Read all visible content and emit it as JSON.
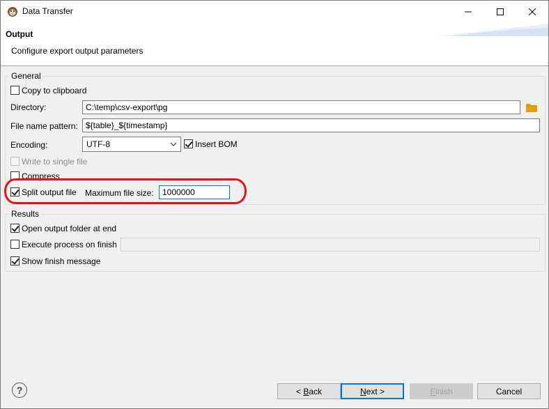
{
  "window": {
    "title": "Data Transfer",
    "icon": "dbeaver-beaver-icon"
  },
  "header": {
    "title": "Output",
    "description": "Configure export output parameters"
  },
  "general": {
    "legend": "General",
    "copy_to_clipboard": {
      "label": "Copy to clipboard",
      "checked": false
    },
    "directory": {
      "label": "Directory:",
      "value": "C:\\temp\\csv-export\\pg"
    },
    "file_name_pattern": {
      "label": "File name pattern:",
      "value": "${table}_${timestamp}"
    },
    "encoding": {
      "label": "Encoding:",
      "value": "UTF-8"
    },
    "insert_bom": {
      "label": "Insert BOM",
      "checked": true
    },
    "write_single_file": {
      "label": "Write to single file",
      "checked": false,
      "disabled": true
    },
    "compress": {
      "label": "Compress",
      "checked": false
    },
    "split_output_file": {
      "label": "Split output file",
      "checked": true
    },
    "max_file_size": {
      "label": "Maximum file size:",
      "value": "1000000"
    }
  },
  "results": {
    "legend": "Results",
    "open_output_folder": {
      "label": "Open output folder at end",
      "checked": true
    },
    "execute_process": {
      "label": "Execute process on finish",
      "checked": false,
      "value": ""
    },
    "show_finish_message": {
      "label": "Show finish message",
      "checked": true
    }
  },
  "footer": {
    "help": "?",
    "back": {
      "prefix": "< ",
      "mnemonic": "B",
      "rest": "ack"
    },
    "next": {
      "mnemonic": "N",
      "rest": "ext >"
    },
    "finish": {
      "mnemonic": "F",
      "rest": "inish"
    },
    "cancel": "Cancel"
  },
  "colors": {
    "highlight": "#e0141e",
    "folder": "#e8a000",
    "focus": "#0078d7"
  }
}
